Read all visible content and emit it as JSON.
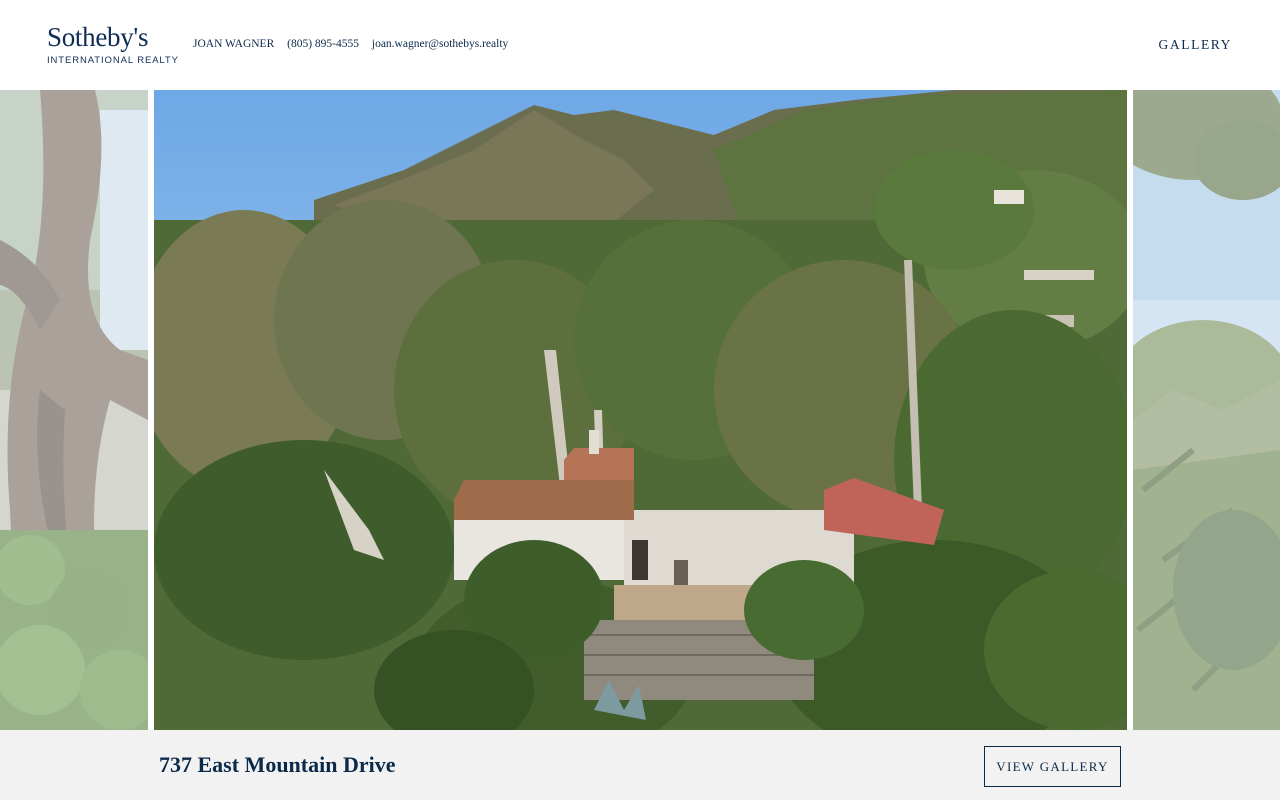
{
  "brand": {
    "name": "Sotheby's",
    "subtitle": "INTERNATIONAL REALTY"
  },
  "agent": {
    "name": "JOAN WAGNER",
    "phone": "(805) 895-4555",
    "email": "joan.wagner@sothebys.realty"
  },
  "nav": {
    "gallery_label": "GALLERY"
  },
  "property": {
    "address": "737 East Mountain Drive"
  },
  "actions": {
    "view_gallery_label": "VIEW GALLERY"
  },
  "colors": {
    "brand_navy": "#0f2d55",
    "text": "#0b2a4a",
    "footer_bg": "#f2f2f2",
    "sky": "#8fc1ec",
    "foliage": "#4a6b34"
  },
  "slides": [
    {
      "role": "previous",
      "subject": "oak-tree-photo"
    },
    {
      "role": "current",
      "subject": "hillside-villa-aerial-photo"
    },
    {
      "role": "next",
      "subject": "coastal-foliage-photo"
    }
  ]
}
